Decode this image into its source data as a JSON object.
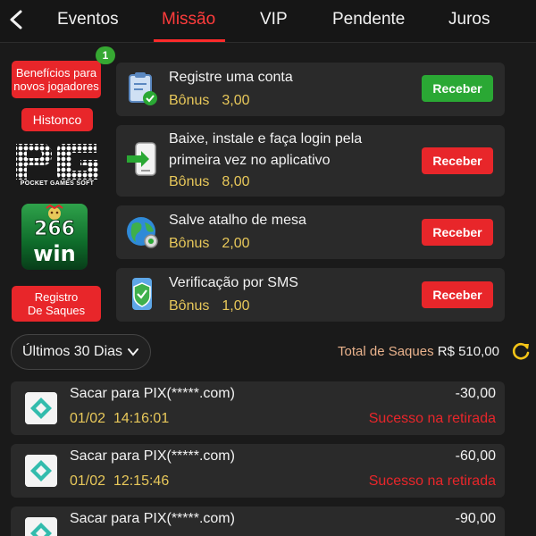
{
  "nav": {
    "tabs": [
      {
        "label": "Eventos"
      },
      {
        "label": "Missão"
      },
      {
        "label": "VIP"
      },
      {
        "label": "Pendente"
      },
      {
        "label": "Juros"
      }
    ],
    "active_tab": "Missão"
  },
  "sidebar": {
    "benefits_label_line1": "Benefícios para",
    "benefits_label_line2": "novos jogadores",
    "badge_count": "1",
    "history_label": "Histonco",
    "pg_logo_text": "PG",
    "pg_caption": "POCKET GAMES SOFT",
    "app_logo_number": "266",
    "app_logo_word": "win",
    "withdraw_record_line1": "Registro",
    "withdraw_record_line2": "De Saques"
  },
  "missions": [
    {
      "title": "Registre uma conta",
      "title_line2": "",
      "bonus_label": "Bônus",
      "bonus_value": "3,00",
      "button": "Receber",
      "icon": "clipboard-check-icon",
      "button_color": "#2aa834"
    },
    {
      "title": "Baixe, instale e faça login pela",
      "title_line2": "primeira vez no aplicativo",
      "bonus_label": "Bônus",
      "bonus_value": "8,00",
      "button": "Receber",
      "icon": "phone-download-icon",
      "button_color": "#e8262a"
    },
    {
      "title": "Salve atalho de mesa",
      "title_line2": "",
      "bonus_label": "Bônus",
      "bonus_value": "2,00",
      "button": "Receber",
      "icon": "globe-shortcut-icon",
      "button_color": "#e8262a"
    },
    {
      "title": "Verificação por SMS",
      "title_line2": "",
      "bonus_label": "Bônus",
      "bonus_value": "1,00",
      "button": "Receber",
      "icon": "shield-phone-icon",
      "button_color": "#e8262a"
    }
  ],
  "filter": {
    "period_label": "Últimos 30 Dias"
  },
  "summary": {
    "total_label": "Total de Saques",
    "total_value": "R$ 510,00"
  },
  "withdrawals": [
    {
      "title": "Sacar para PIX(*****.com)",
      "date": "01/02",
      "time": "14:16:01",
      "amount": "-30,00",
      "status": "Sucesso na retirada"
    },
    {
      "title": "Sacar para PIX(*****.com)",
      "date": "01/02",
      "time": "12:15:46",
      "amount": "-60,00",
      "status": "Sucesso na retirada"
    },
    {
      "title": "Sacar para PIX(*****.com)",
      "date": "",
      "time": "",
      "amount": "-90,00",
      "status": ""
    }
  ],
  "colors": {
    "accent_red": "#e8262a",
    "accent_green": "#2aa834",
    "bonus_gold": "#e8c85a",
    "background": "#1a1a1a",
    "card": "#2a2a2a"
  }
}
